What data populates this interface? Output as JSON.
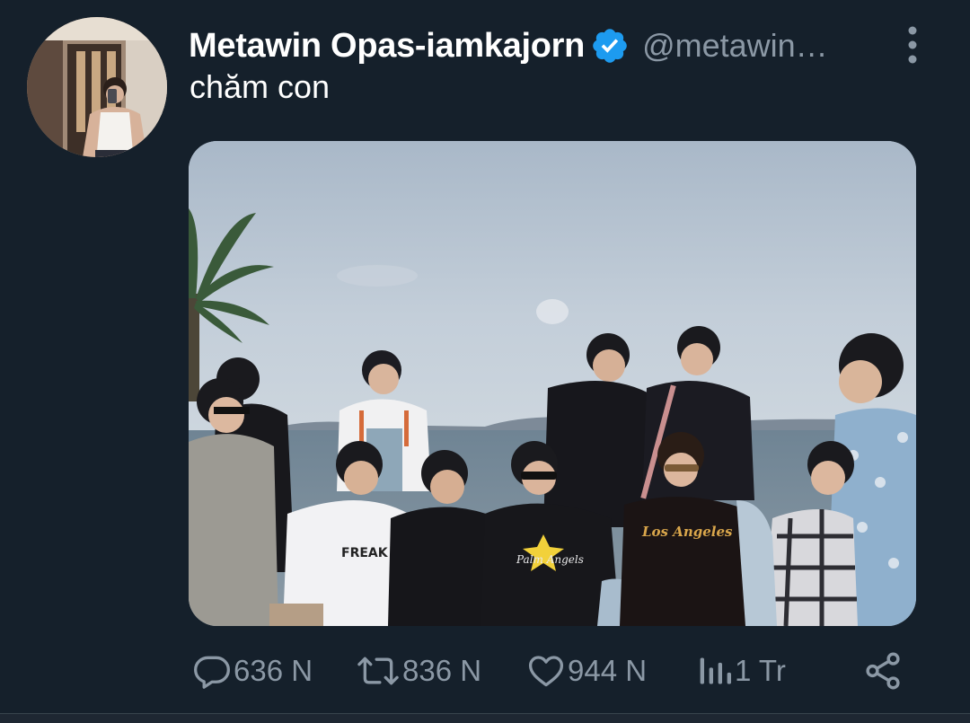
{
  "tweet": {
    "author": {
      "display_name": "Metawin Opas-iamkajorn",
      "handle": "@metawin…",
      "verified_icon": "verified-badge-icon",
      "avatar": "profile-photo"
    },
    "text": "chăm con",
    "media": {
      "type": "photo",
      "subject": "group-photo-by-the-sea",
      "shirt_prints": [
        "FREAK",
        "Palm Angels",
        "Los Angeles"
      ]
    },
    "actions": {
      "replies": {
        "icon": "reply-icon",
        "count": "636 N"
      },
      "retweets": {
        "icon": "retweet-icon",
        "count": "836 N"
      },
      "likes": {
        "icon": "heart-icon",
        "count": "944 N"
      },
      "views": {
        "icon": "views-chart-icon",
        "count": "1 Tr"
      },
      "share": {
        "icon": "share-icon"
      }
    },
    "more_icon": "more-vertical-icon"
  },
  "colors": {
    "background": "#15202b",
    "primary_text": "#ffffff",
    "secondary_text": "#8b98a5",
    "verified_blue": "#1d9bf0"
  }
}
